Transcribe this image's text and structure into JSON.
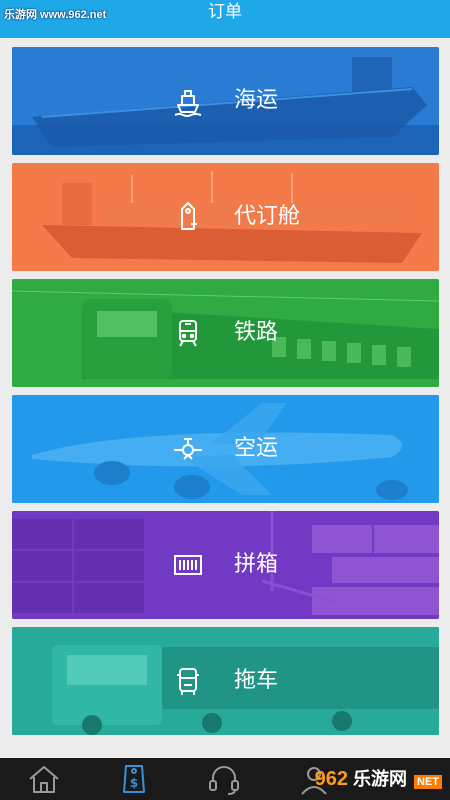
{
  "header": {
    "title": "订单",
    "watermark": "乐游网 www.962.net"
  },
  "cards": [
    {
      "label": "海运",
      "icon": "ship-icon"
    },
    {
      "label": "代订舱",
      "icon": "booking-tag-icon"
    },
    {
      "label": "铁路",
      "icon": "train-icon"
    },
    {
      "label": "空运",
      "icon": "airplane-icon"
    },
    {
      "label": "拼箱",
      "icon": "container-icon"
    },
    {
      "label": "拖车",
      "icon": "truck-icon"
    }
  ],
  "tabbar": {
    "items": [
      "home-icon",
      "order-icon",
      "headset-icon",
      "profile-icon"
    ],
    "brand_num": "962",
    "brand_text": "乐游网",
    "brand_net": "NET"
  }
}
